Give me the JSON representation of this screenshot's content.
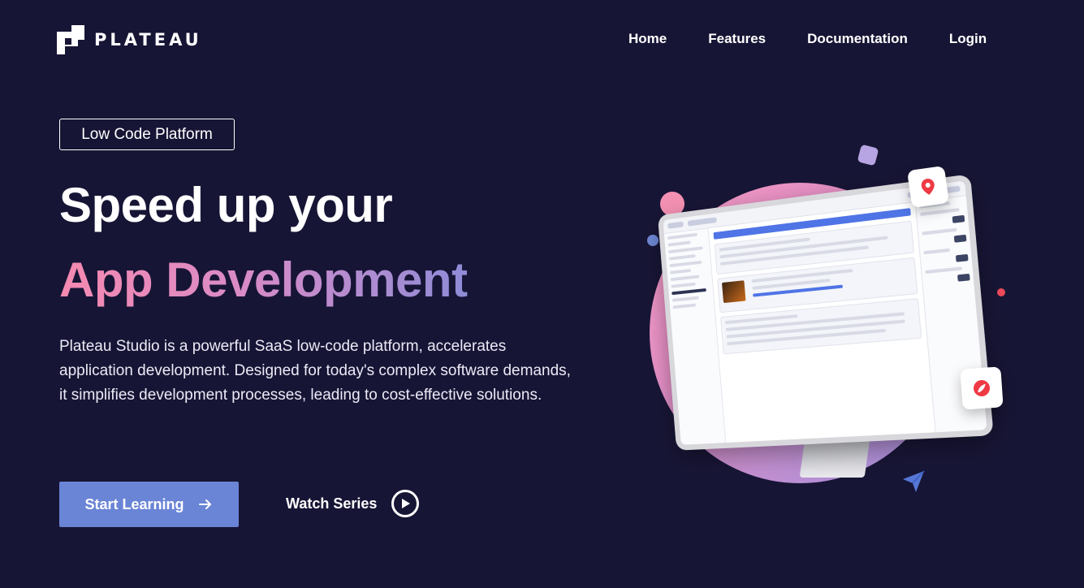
{
  "header": {
    "logo_text": "PLATEAU",
    "nav": [
      {
        "label": "Home"
      },
      {
        "label": "Features"
      },
      {
        "label": "Documentation"
      },
      {
        "label": "Login"
      }
    ]
  },
  "hero": {
    "tag": "Low Code Platform",
    "headline_line1": "Speed up your",
    "headline_line2": "App Development",
    "description": "Plateau Studio is a powerful SaaS low-code platform, accelerates application development. Designed for today's complex software demands, it simplifies development processes, leading to cost-effective solutions.",
    "primary_button": "Start Learning",
    "secondary_button": "Watch Series"
  },
  "colors": {
    "background": "#171535",
    "primary_button": "#6a84d6",
    "gradient_start": "#f58ab0",
    "gradient_end": "#8e8cd8"
  },
  "icons": {
    "logo": "plateau-logo-icon",
    "arrow": "arrow-right-icon",
    "play": "play-icon",
    "location": "location-pin-icon",
    "paper_plane": "paper-plane-icon"
  }
}
